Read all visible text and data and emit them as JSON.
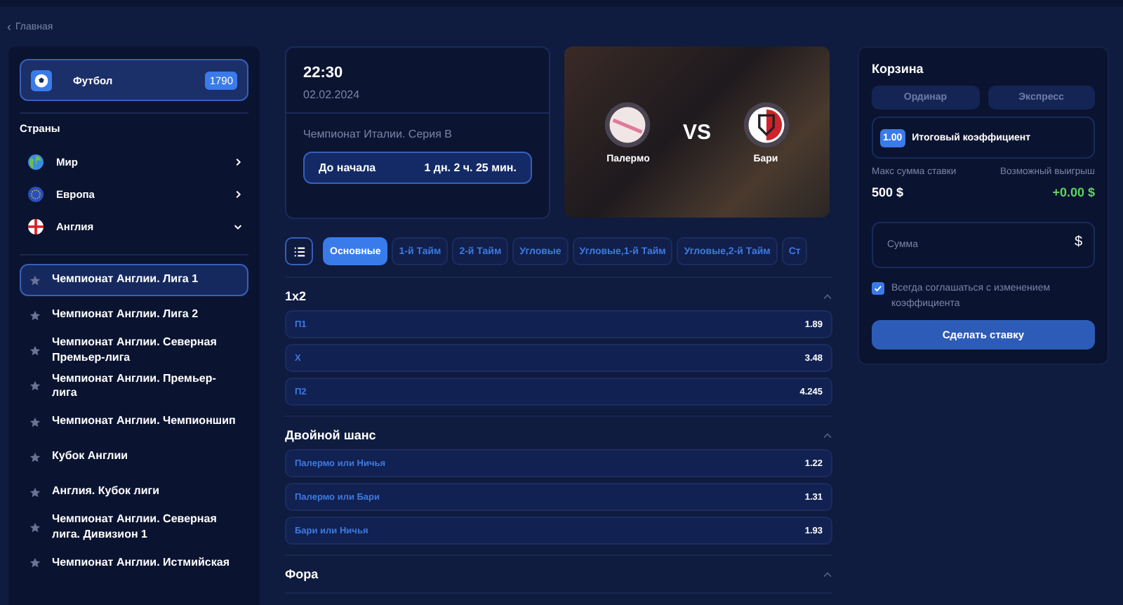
{
  "breadcrumb": {
    "icon": "‹",
    "label": "Главная"
  },
  "sport": {
    "label": "Футбол",
    "count": "1790"
  },
  "countries_title": "Страны",
  "countries": [
    {
      "kind": "globe",
      "label": "Мир",
      "expanded": false
    },
    {
      "kind": "eu",
      "label": "Европа",
      "expanded": false
    },
    {
      "kind": "england",
      "label": "Англия",
      "expanded": true
    }
  ],
  "leagues": [
    {
      "label": "Чемпионат Англии. Лига 1",
      "selected": true
    },
    {
      "label": "Чемпионат Англии. Лига 2",
      "selected": false
    },
    {
      "label": "Чемпионат Англии. Северная Премьер-лига",
      "selected": false
    },
    {
      "label": "Чемпионат Англии. Премьер-лига",
      "selected": false
    },
    {
      "label": "Чемпионат Англии. Чемпионшип",
      "selected": false
    },
    {
      "label": "Кубок Англии",
      "selected": false
    },
    {
      "label": "Англия. Кубок лиги",
      "selected": false
    },
    {
      "label": "Чемпионат Англии. Северная лига. Дивизион 1",
      "selected": false
    },
    {
      "label": "Чемпионат Англии. Истмийская",
      "selected": false
    }
  ],
  "match": {
    "time": "22:30",
    "date": "02.02.2024",
    "league": "Чемпионат Италии. Серия B",
    "countdown_label": "До начала",
    "countdown": "1 дн. 2 ч. 25 мин.",
    "home": "Палермо",
    "away": "Бари",
    "vs": "VS"
  },
  "tabs": [
    {
      "label": "Основные",
      "selected": true
    },
    {
      "label": "1-й Тайм",
      "selected": false
    },
    {
      "label": "2-й Тайм",
      "selected": false
    },
    {
      "label": "Угловые",
      "selected": false
    },
    {
      "label": "Угловые,1-й Тайм",
      "selected": false
    },
    {
      "label": "Угловые,2-й Тайм",
      "selected": false
    },
    {
      "label": "Ст",
      "selected": false
    }
  ],
  "markets": [
    {
      "title": "1x2",
      "expanded": true,
      "outcomes": [
        {
          "label": "П1",
          "odds": "1.89"
        },
        {
          "label": "X",
          "odds": "3.48"
        },
        {
          "label": "П2",
          "odds": "4.245"
        }
      ]
    },
    {
      "title": "Двойной шанс",
      "expanded": true,
      "outcomes": [
        {
          "label": "Палермо или Ничья",
          "odds": "1.22"
        },
        {
          "label": "Палермо или Бари",
          "odds": "1.31"
        },
        {
          "label": "Бари или Ничья",
          "odds": "1.93"
        }
      ]
    },
    {
      "title": "Фора",
      "expanded": true
    }
  ],
  "slip": {
    "title": "Корзина",
    "types": [
      {
        "label": "Ординар",
        "selected": false
      },
      {
        "label": "Экспресс",
        "selected": false
      }
    ],
    "total_odds": "1.00",
    "total_label": "Итоговый коэффициент",
    "max_label": "Макс сумма ставки",
    "max_value": "500 $",
    "win_label": "Возможный выигрыш",
    "win_value": "+0.00 $",
    "amount_placeholder": "Сумма",
    "currency": "$",
    "agree": {
      "label": "Всегда соглашаться с изменением коэффициента",
      "checked": true
    },
    "submit": "Сделать ставку"
  }
}
